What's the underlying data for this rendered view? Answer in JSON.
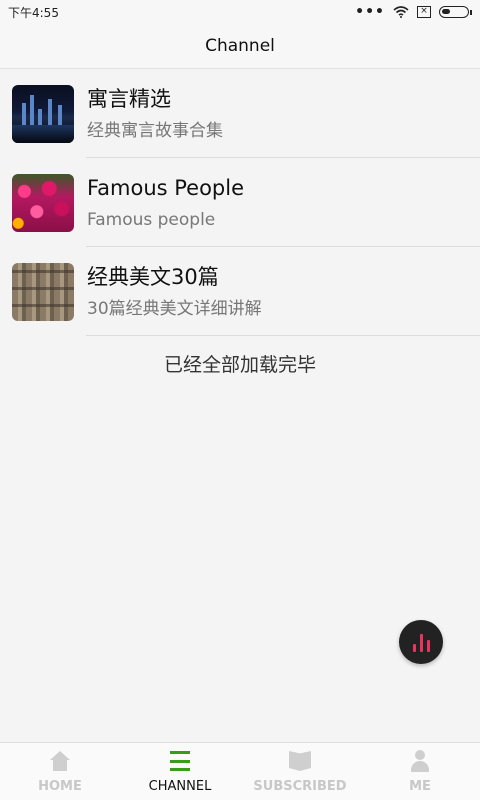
{
  "status_bar": {
    "time": "下午4:55",
    "dots": "•••"
  },
  "header": {
    "title": "Channel"
  },
  "channels": [
    {
      "title": "寓言精选",
      "subtitle": "经典寓言故事合集",
      "thumb_icon": "city-night-thumbnail"
    },
    {
      "title": "Famous People",
      "subtitle": "Famous people",
      "thumb_icon": "flower-field-thumbnail"
    },
    {
      "title": "经典美文30篇",
      "subtitle": "30篇经典美文详细讲解",
      "thumb_icon": "wooden-fence-thumbnail"
    }
  ],
  "list_end_message": "已经全部加载完毕",
  "fab": {
    "icon": "audio-bars-icon"
  },
  "tabs": [
    {
      "label": "HOME",
      "icon": "home-icon",
      "active": false
    },
    {
      "label": "CHANNEL",
      "icon": "list-icon",
      "active": true
    },
    {
      "label": "SUBSCRIBED",
      "icon": "book-icon",
      "active": false
    },
    {
      "label": "ME",
      "icon": "person-icon",
      "active": false
    }
  ],
  "colors": {
    "accent": "#3a9a1a",
    "fab": "#222222",
    "fab_bars": "#e8355f"
  }
}
